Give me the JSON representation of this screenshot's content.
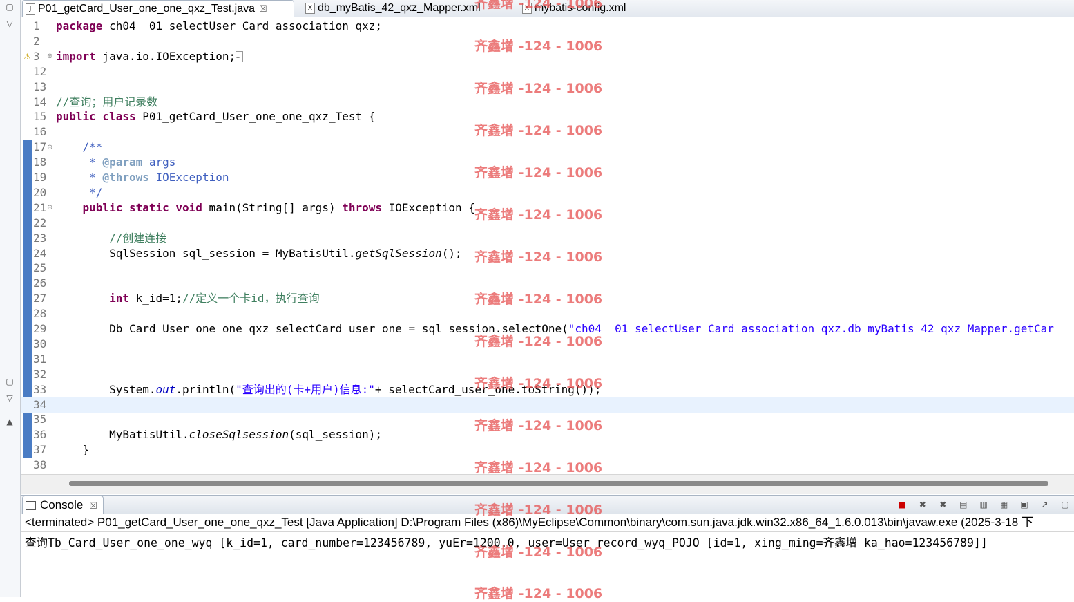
{
  "tabs": [
    {
      "label": "P01_getCard_User_one_one_qxz_Test.java",
      "icon": "J",
      "active": true,
      "close": "☒"
    },
    {
      "label": "db_myBatis_42_qxz_Mapper.xml",
      "icon": "X",
      "active": false
    },
    {
      "label": "mybatis-config.xml",
      "icon": "X",
      "active": false
    }
  ],
  "code": {
    "lines": [
      {
        "n": "1",
        "segs": [
          [
            "kw",
            "package"
          ],
          [
            "t",
            " ch04__01_selectUser_Card_association_qxz;"
          ]
        ]
      },
      {
        "n": "2",
        "segs": []
      },
      {
        "n": "3",
        "segs": [
          [
            "kw",
            "import"
          ],
          [
            "t",
            " java.io.IOException;"
          ],
          [
            "box",
            "…"
          ]
        ]
      },
      {
        "n": "12",
        "segs": []
      },
      {
        "n": "13",
        "segs": []
      },
      {
        "n": "14",
        "segs": [
          [
            "cm",
            "//查询；用户记录数"
          ]
        ]
      },
      {
        "n": "15",
        "segs": [
          [
            "kw",
            "public class"
          ],
          [
            "t",
            " P01_getCard_User_one_one_qxz_Test {"
          ]
        ]
      },
      {
        "n": "16",
        "segs": []
      },
      {
        "n": "17",
        "segs": [
          [
            "t",
            "    "
          ],
          [
            "jd",
            "/**"
          ]
        ]
      },
      {
        "n": "18",
        "segs": [
          [
            "t",
            "     "
          ],
          [
            "jd",
            "* "
          ],
          [
            "jdtag",
            "@param"
          ],
          [
            "jd",
            " args"
          ]
        ]
      },
      {
        "n": "19",
        "segs": [
          [
            "t",
            "     "
          ],
          [
            "jd",
            "* "
          ],
          [
            "jdtag",
            "@throws"
          ],
          [
            "jd",
            " IOException"
          ]
        ]
      },
      {
        "n": "20",
        "segs": [
          [
            "t",
            "     "
          ],
          [
            "jd",
            "*/"
          ]
        ]
      },
      {
        "n": "21",
        "segs": [
          [
            "t",
            "    "
          ],
          [
            "kw",
            "public static void"
          ],
          [
            "t",
            " main(String[] args) "
          ],
          [
            "kw",
            "throws"
          ],
          [
            "t",
            " IOException {"
          ]
        ]
      },
      {
        "n": "22",
        "segs": []
      },
      {
        "n": "23",
        "segs": [
          [
            "t",
            "        "
          ],
          [
            "cm",
            "//创建连接"
          ]
        ]
      },
      {
        "n": "24",
        "segs": [
          [
            "t",
            "        SqlSession sql_session = MyBatisUtil."
          ],
          [
            "it",
            "getSqlSession"
          ],
          [
            "t",
            "();"
          ]
        ]
      },
      {
        "n": "25",
        "segs": []
      },
      {
        "n": "26",
        "segs": []
      },
      {
        "n": "27",
        "segs": [
          [
            "t",
            "        "
          ],
          [
            "kw",
            "int"
          ],
          [
            "t",
            " k_id=1;"
          ],
          [
            "cm",
            "//定义一个卡id，执行查询"
          ]
        ]
      },
      {
        "n": "28",
        "segs": []
      },
      {
        "n": "29",
        "segs": [
          [
            "t",
            "        Db_Card_User_one_one_qxz selectCard_user_one = sql_session.selectOne("
          ],
          [
            "str",
            "\"ch04__01_selectUser_Card_association_qxz.db_myBatis_42_qxz_Mapper.getCar"
          ]
        ]
      },
      {
        "n": "30",
        "segs": []
      },
      {
        "n": "31",
        "segs": []
      },
      {
        "n": "32",
        "segs": []
      },
      {
        "n": "33",
        "segs": [
          [
            "t",
            "        System."
          ],
          [
            "field",
            "out"
          ],
          [
            "t",
            ".println("
          ],
          [
            "str",
            "\"查询出的(卡+用户)信息:\""
          ],
          [
            "t",
            "+ selectCard_user_one.toString());"
          ]
        ]
      },
      {
        "n": "34",
        "segs": [],
        "highlight": true
      },
      {
        "n": "35",
        "segs": []
      },
      {
        "n": "36",
        "segs": [
          [
            "t",
            "        MyBatisUtil."
          ],
          [
            "it",
            "closeSqlsession"
          ],
          [
            "t",
            "(sql_session);"
          ]
        ]
      },
      {
        "n": "37",
        "segs": [
          [
            "t",
            "    }"
          ]
        ]
      },
      {
        "n": "38",
        "segs": []
      }
    ]
  },
  "console": {
    "tab_label": "Console",
    "tab_close": "☒",
    "status": "<terminated> P01_getCard_User_one_one_qxz_Test [Java Application] D:\\Program Files (x86)\\MyEclipse\\Common\\binary\\com.sun.java.jdk.win32.x86_64_1.6.0.013\\bin\\javaw.exe (2025-3-18 下",
    "output": "查询Tb_Card_User_one_one_wyq [k_id=1, card_number=123456789, yuEr=1200.0, user=User_record_wyq_POJO [id=1, xing_ming=齐鑫增 ka_hao=123456789]]",
    "toolbar_icons": [
      "stop-icon",
      "remove-launch-icon",
      "remove-all-icon",
      "clear-console-icon",
      "scroll-lock-icon",
      "pin-console-icon",
      "display-selected-icon",
      "open-console-icon",
      "new-console-icon"
    ]
  },
  "watermark": {
    "text": "齐鑫增 -124 - 1006",
    "color": "#e65050"
  }
}
